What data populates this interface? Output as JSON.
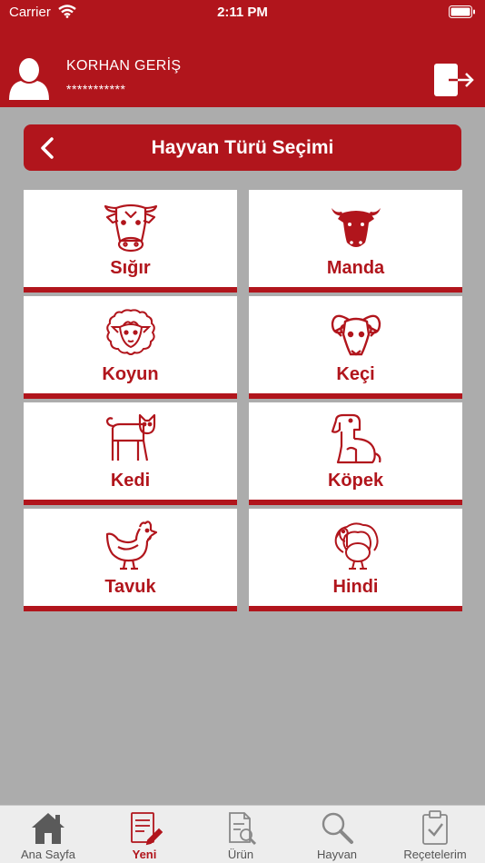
{
  "status_bar": {
    "carrier": "Carrier",
    "time": "2:11 PM"
  },
  "header": {
    "user_name": "KORHAN GERİŞ",
    "password_mask": "***********"
  },
  "title_bar": {
    "title": "Hayvan Türü Seçimi"
  },
  "animals": [
    {
      "label": "Sığır",
      "icon": "cow-icon"
    },
    {
      "label": "Manda",
      "icon": "buffalo-icon"
    },
    {
      "label": "Koyun",
      "icon": "sheep-icon"
    },
    {
      "label": "Keçi",
      "icon": "goat-icon"
    },
    {
      "label": "Kedi",
      "icon": "cat-icon"
    },
    {
      "label": "Köpek",
      "icon": "dog-icon"
    },
    {
      "label": "Tavuk",
      "icon": "chicken-icon"
    },
    {
      "label": "Hindi",
      "icon": "turkey-icon"
    }
  ],
  "tabs": [
    {
      "label": "Ana Sayfa",
      "icon": "home-icon",
      "active": false
    },
    {
      "label": "Yeni",
      "icon": "new-document-icon",
      "active": true
    },
    {
      "label": "Ürün",
      "icon": "product-search-icon",
      "active": false
    },
    {
      "label": "Hayvan",
      "icon": "magnifier-icon",
      "active": false
    },
    {
      "label": "Reçetelerim",
      "icon": "clipboard-check-icon",
      "active": false
    }
  ],
  "colors": {
    "brand_red": "#b1151c",
    "background_gray": "#acacac",
    "tab_bar": "#ededed"
  }
}
